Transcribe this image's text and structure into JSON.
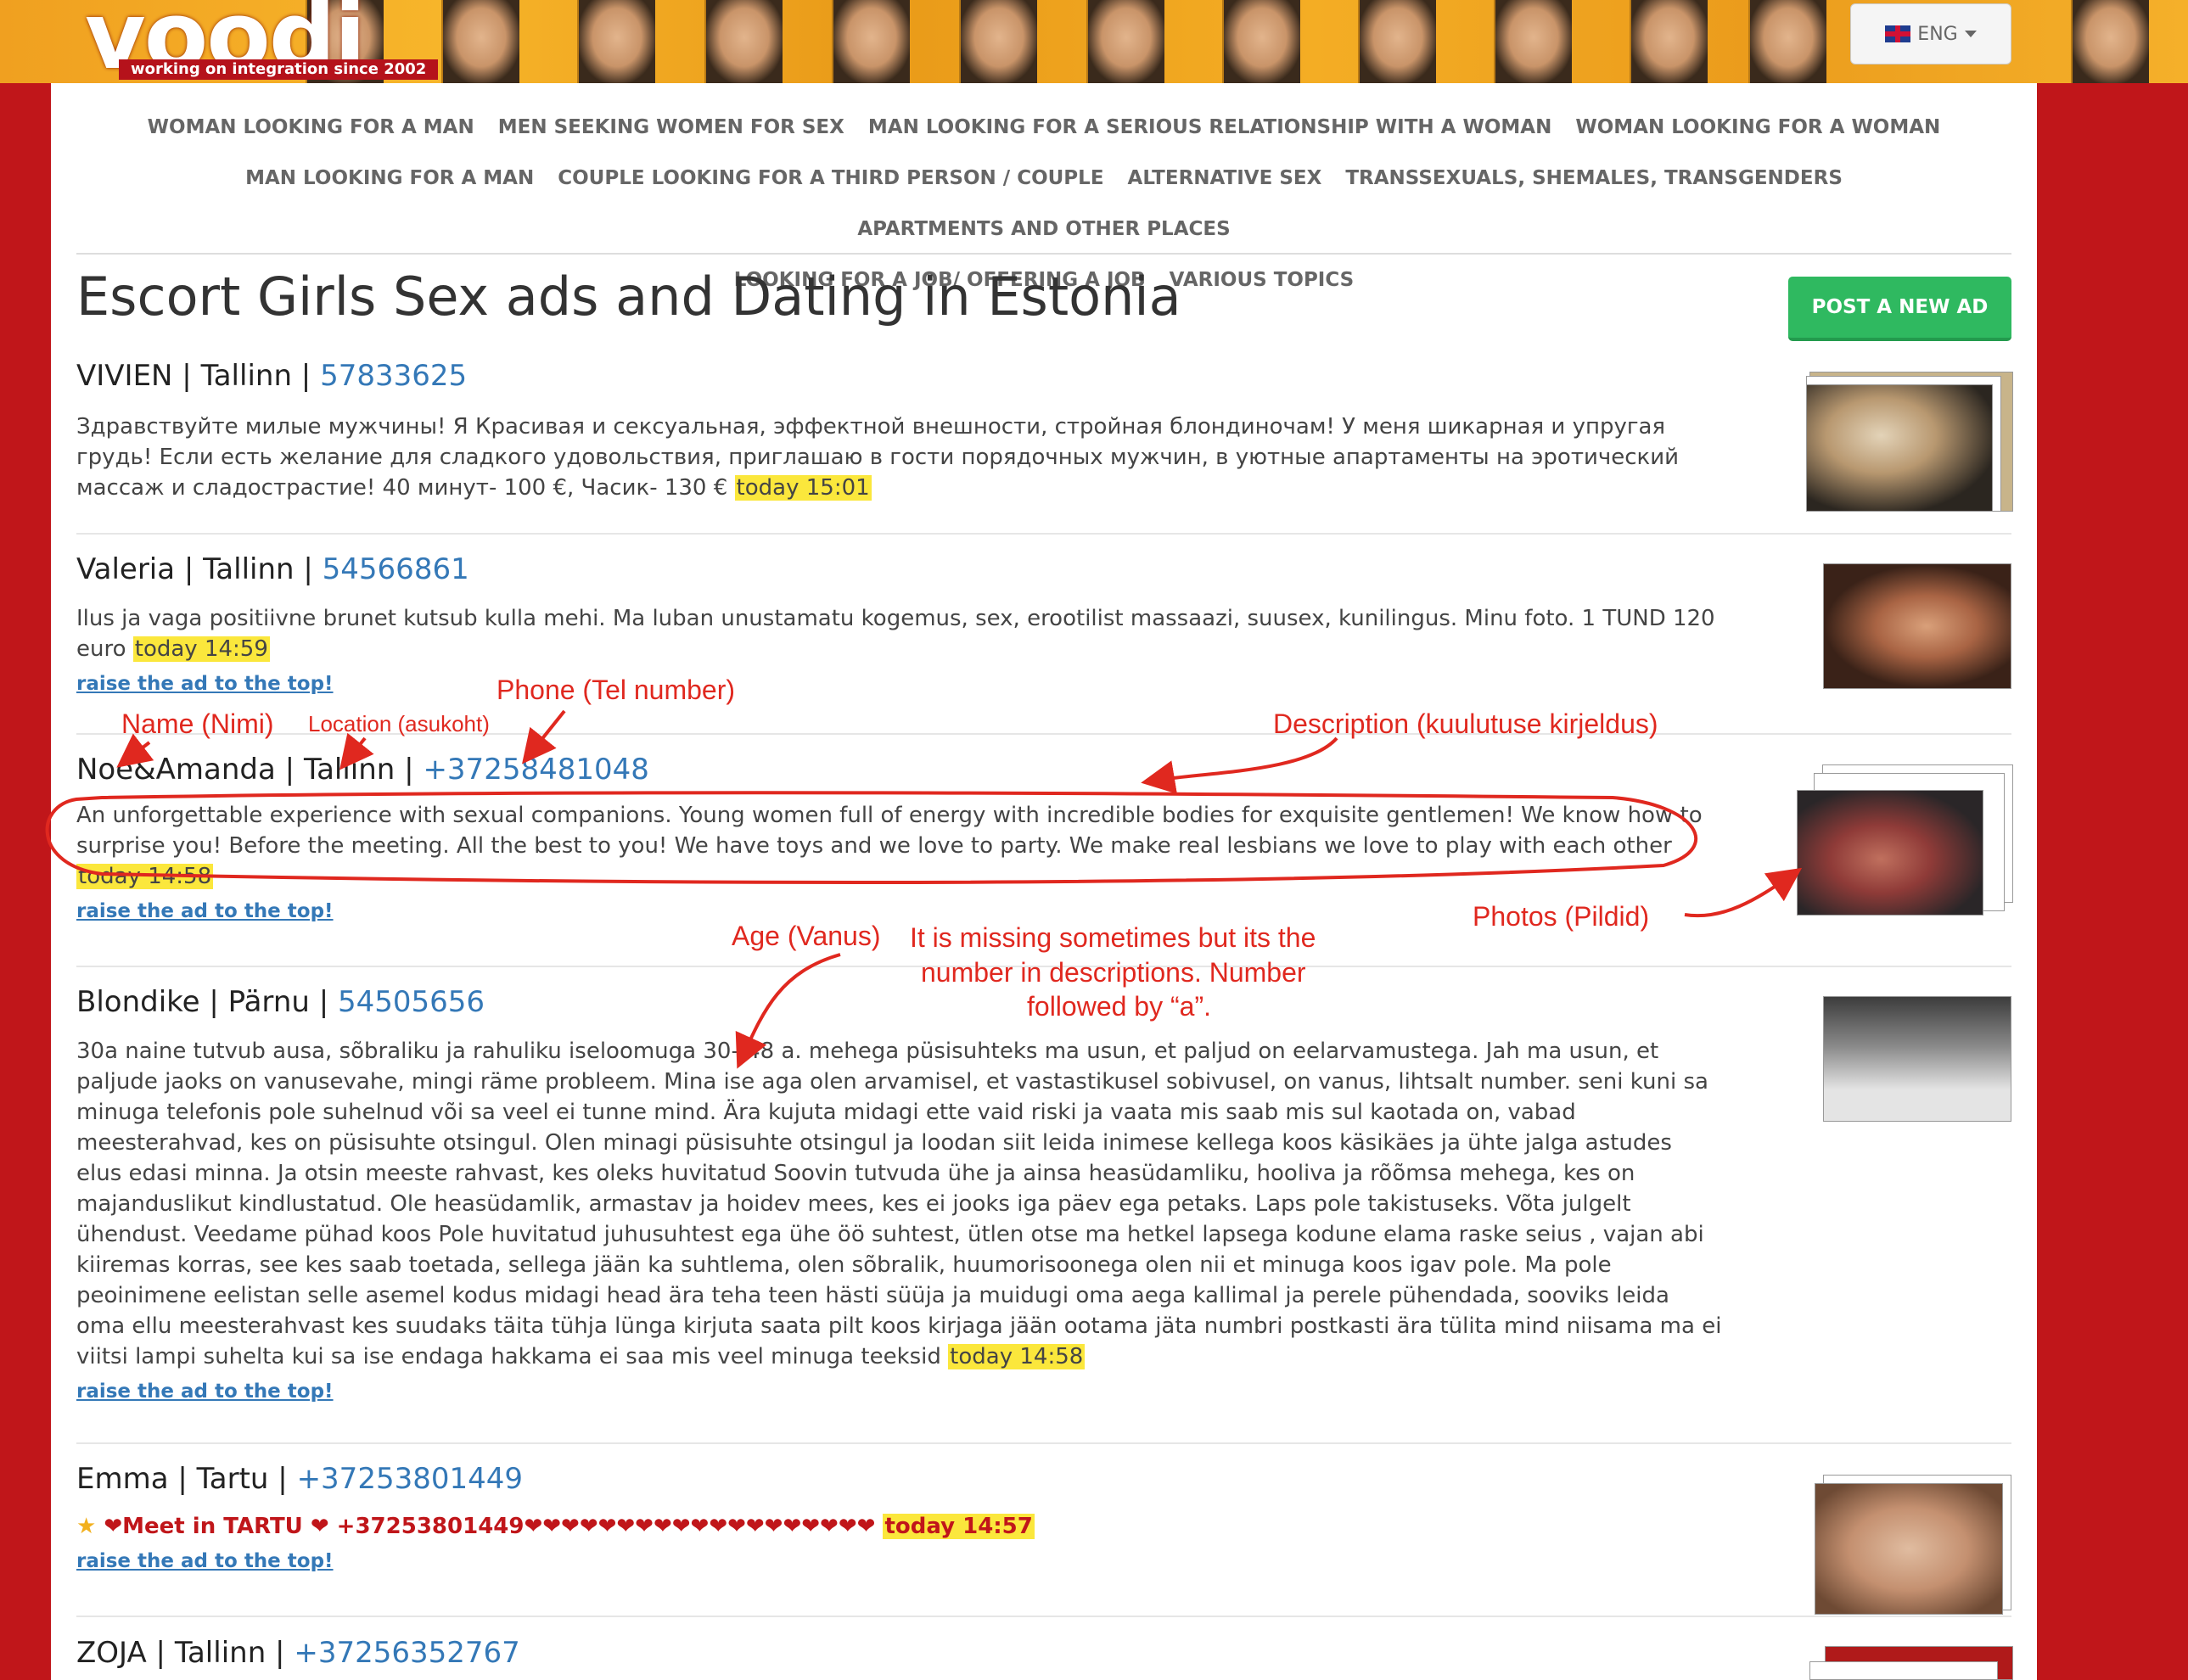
{
  "header": {
    "logo_text": "voodi",
    "logo_tagline": "working on integration since 2002",
    "language": "ENG"
  },
  "nav": [
    "WOMAN LOOKING FOR A MAN",
    "MEN SEEKING WOMEN FOR SEX",
    "MAN LOOKING FOR A SERIOUS RELATIONSHIP WITH A WOMAN",
    "WOMAN LOOKING FOR A WOMAN",
    "MAN LOOKING FOR A MAN",
    "COUPLE LOOKING FOR A THIRD PERSON / COUPLE",
    "ALTERNATIVE SEX",
    "TRANSSEXUALS, SHEMALES, TRANSGENDERS",
    "APARTMENTS AND OTHER PLACES",
    "LOOKING FOR A JOB/ OFFERING A JOB",
    "VARIOUS TOPICS"
  ],
  "page": {
    "title": "Escort Girls Sex ads and Dating in Estonia",
    "post_button": "POST A NEW AD",
    "raise_label": "raise the ad to the top!"
  },
  "ads": [
    {
      "name": "VIVIEN",
      "city": "Tallinn",
      "phone": "57833625",
      "desc": "Здравствуйте милые мужчины! Я Красивая и сексуальная, эффектной внешности, стройная блондиночам! У меня шикарная и упругая грудь! Если есть желание для сладкого удовольствия, приглашаю в гости порядочных мужчин, в уютные апартаменты на эротический массаж и сладострастие! 40 минут- 100 €, Часик- 130 €",
      "time": "today 15:01"
    },
    {
      "name": "Valeria",
      "city": "Tallinn",
      "phone": "54566861",
      "desc": "Ilus ja vaga positiivne brunet kutsub kulla mehi. Ma luban unustamatu kogemus, sex, erootilist massaazi, suusex, kunilingus. Minu foto. 1 TUND 120 euro",
      "time": "today 14:59"
    },
    {
      "name": "Noe&Amanda",
      "city": "Tallinn",
      "phone": "+37258481048",
      "desc": "An unforgettable experience with sexual companions. Young women full of energy with incredible bodies for exquisite gentlemen! We know how to surprise you! Before the meeting. All the best to you! We have toys and we love to party. We make real lesbians we love to play with each other",
      "time": "today 14:58"
    },
    {
      "name": "Blondike",
      "city": "Pärnu",
      "phone": "54505656",
      "desc": "30a naine tutvub ausa, sõbraliku ja rahuliku iseloomuga 30- 48 a. mehega püsisuhteks ma usun, et paljud on eelarvamustega. Jah ma usun, et paljude jaoks on vanusevahe, mingi räme probleem. Mina ise aga olen arvamisel, et vastastikusel sobivusel, on vanus, lihtsalt number. seni kuni sa minuga telefonis pole suhelnud või sa veel ei tunne mind. Ära kujuta midagi ette vaid riski ja vaata mis saab mis sul kaotada on, vabad meesterahvad, kes on püsisuhte otsingul. Olen minagi püsisuhte otsingul ja loodan siit leida inimese kellega koos käsikäes ja ühte jalga astudes elus edasi minna. Ja otsin meeste rahvast, kes oleks huvitatud Soovin tutvuda ühe ja ainsa heasüdamliku, hooliva ja rõõmsa mehega, kes on majanduslikut kindlustatud. Ole heasüdamlik, armastav ja hoidev mees, kes ei jooks iga päev ega petaks. Laps pole takistuseks. Võta julgelt ühendust. Veedame pühad koos Pole huvitatud juhusuhtest ega ühe öö suhtest, ütlen otse ma hetkel lapsega kodune elama raske seius , vajan abi kiiremas korras, see kes saab toetada, sellega jään ka suhtlema, olen sõbralik, huumorisoonega olen nii et minuga koos igav pole. Ma pole peoinimene eelistan selle asemel kodus midagi head ära teha teen hästi süüja ja muidugi oma aega kallimal ja perele pühendada, sooviks leida oma ellu meesterahvast kes suudaks täita tühja lünga  kirjuta saata pilt koos kirjaga jään ootama jäta numbri postkasti ära tülita mind niisama ma ei viitsi lampi suhelta kui sa ise endaga hakkama ei saa mis veel minuga teeksid",
      "time": "today 14:58"
    },
    {
      "name": "Emma",
      "city": "Tartu",
      "phone": "+37253801449",
      "desc": "❤Meet in TARTU ❤ +37253801449❤❤❤❤❤❤❤❤❤❤❤❤❤❤❤❤❤❤❤",
      "time": "today 14:57"
    },
    {
      "name": "ZOJA",
      "city": "Tallinn",
      "phone": "+37256352767"
    }
  ],
  "annotations": {
    "name": "Name (Nimi)",
    "location": "Location (asukoht)",
    "phone": "Phone (Tel number)",
    "description": "Description (kuulutuse kirjeldus)",
    "photos": "Photos (Pildid)",
    "age": "Age (Vanus)",
    "age_note_1": "It is missing sometimes but its the",
    "age_note_2": "number in descriptions. Number",
    "age_note_3": "followed by “a”."
  },
  "colors": {
    "background": "#c0161a",
    "link": "#3478b7",
    "highlight": "#fbe73c",
    "button": "#2fb960",
    "annotation": "#e0281f"
  }
}
